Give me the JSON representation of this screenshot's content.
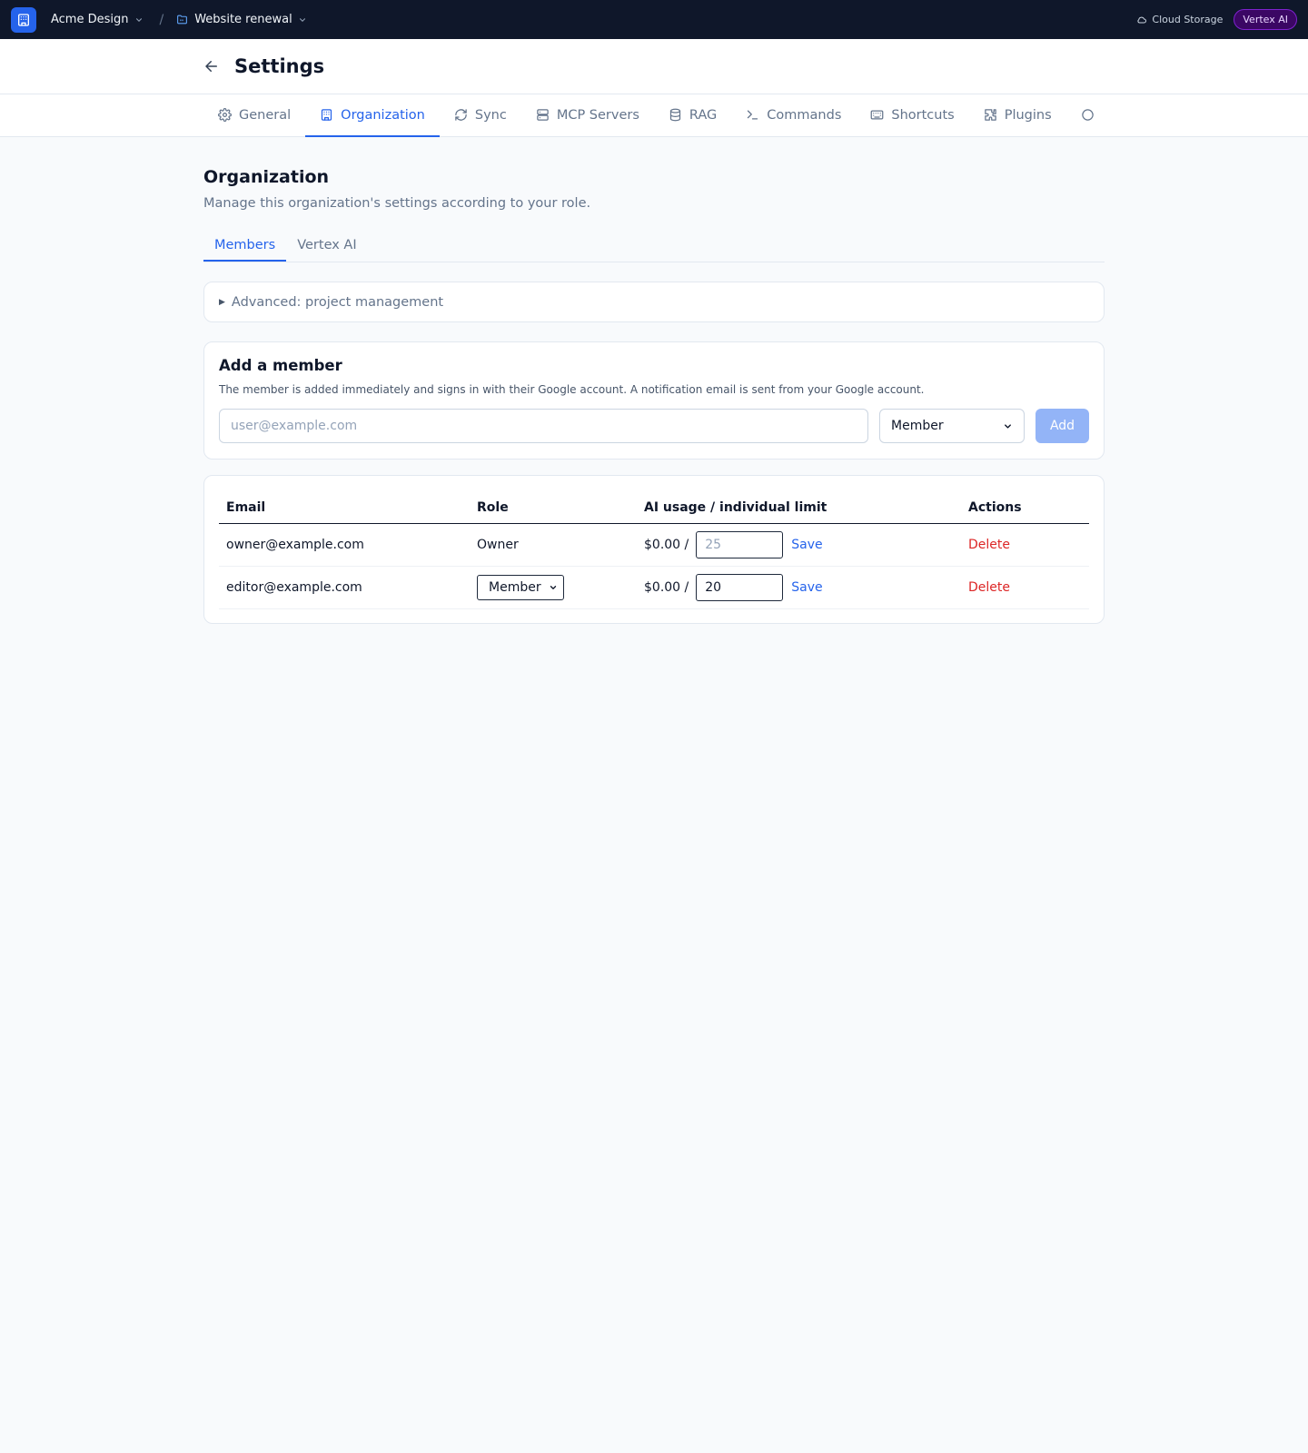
{
  "topbar": {
    "org_name": "Acme Design",
    "separator": "/",
    "project_name": "Website renewal",
    "storage_label": "Cloud Storage",
    "vertex_badge": "Vertex AI"
  },
  "header": {
    "title": "Settings"
  },
  "nav_tabs": [
    {
      "label": "General",
      "icon": "gear-icon"
    },
    {
      "label": "Organization",
      "icon": "building-icon",
      "active": true
    },
    {
      "label": "Sync",
      "icon": "refresh-icon"
    },
    {
      "label": "MCP Servers",
      "icon": "server-icon"
    },
    {
      "label": "RAG",
      "icon": "database-icon"
    },
    {
      "label": "Commands",
      "icon": "terminal-icon"
    },
    {
      "label": "Shortcuts",
      "icon": "keyboard-icon"
    },
    {
      "label": "Plugins",
      "icon": "puzzle-icon"
    }
  ],
  "section": {
    "title": "Organization",
    "description": "Manage this organization's settings according to your role."
  },
  "sub_tabs": [
    {
      "label": "Members",
      "active": true
    },
    {
      "label": "Vertex AI"
    }
  ],
  "advanced": {
    "label": "Advanced: project management"
  },
  "add_member": {
    "title": "Add a member",
    "description": "The member is added immediately and signs in with their Google account. A notification email is sent from your Google account.",
    "email_placeholder": "user@example.com",
    "email_value": "",
    "role_selected": "Member",
    "add_label": "Add"
  },
  "members_table": {
    "headers": [
      "Email",
      "Role",
      "AI usage / individual limit",
      "Actions"
    ],
    "rows": [
      {
        "email": "owner@example.com",
        "role": "Owner",
        "usage": "$0.00 /",
        "limit_value": "",
        "limit_placeholder": "25",
        "save_label": "Save",
        "delete_label": "Delete"
      },
      {
        "email": "editor@example.com",
        "role": "Member",
        "usage": "$0.00 /",
        "limit_value": "20",
        "limit_placeholder": "",
        "save_label": "Save",
        "delete_label": "Delete"
      }
    ]
  },
  "colors": {
    "topbar_bg": "#0f172a",
    "accent": "#2563eb",
    "danger": "#dc2626",
    "badge_bg": "#3b0764"
  }
}
